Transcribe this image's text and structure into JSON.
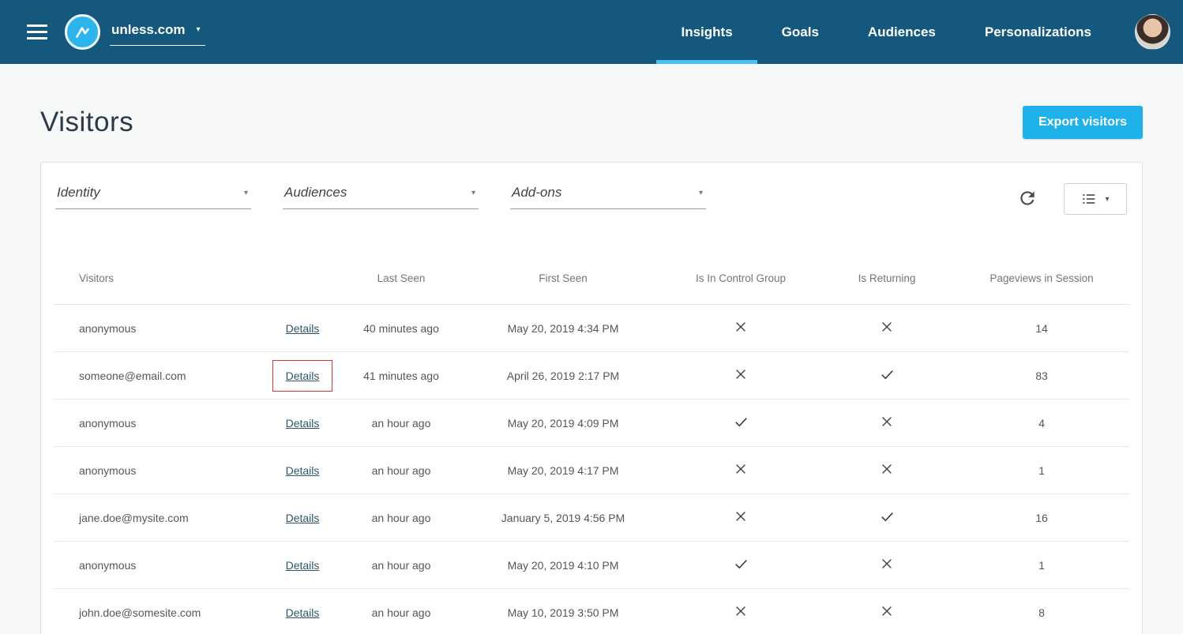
{
  "navbar": {
    "site_name": "unless.com",
    "nav_items": [
      {
        "label": "Insights",
        "active": true
      },
      {
        "label": "Goals",
        "active": false
      },
      {
        "label": "Audiences",
        "active": false
      },
      {
        "label": "Personalizations",
        "active": false
      }
    ]
  },
  "page": {
    "title": "Visitors",
    "export_button": "Export visitors"
  },
  "filters": {
    "dropdowns": [
      {
        "label": "Identity"
      },
      {
        "label": "Audiences"
      },
      {
        "label": "Add-ons"
      }
    ]
  },
  "table": {
    "headers": [
      "Visitors",
      "Last Seen",
      "First Seen",
      "Is In Control Group",
      "Is Returning",
      "Pageviews in Session"
    ],
    "details_label": "Details",
    "rows": [
      {
        "identity": "anonymous",
        "last_seen": "40 minutes ago",
        "first_seen": "May 20, 2019 4:34 PM",
        "in_control_group": false,
        "is_returning": false,
        "pageviews": "14",
        "details_highlighted": false
      },
      {
        "identity": "someone@email.com",
        "last_seen": "41 minutes ago",
        "first_seen": "April 26, 2019 2:17 PM",
        "in_control_group": false,
        "is_returning": true,
        "pageviews": "83",
        "details_highlighted": true
      },
      {
        "identity": "anonymous",
        "last_seen": "an hour ago",
        "first_seen": "May 20, 2019 4:09 PM",
        "in_control_group": true,
        "is_returning": false,
        "pageviews": "4",
        "details_highlighted": false
      },
      {
        "identity": "anonymous",
        "last_seen": "an hour ago",
        "first_seen": "May 20, 2019 4:17 PM",
        "in_control_group": false,
        "is_returning": false,
        "pageviews": "1",
        "details_highlighted": false
      },
      {
        "identity": "jane.doe@mysite.com",
        "last_seen": "an hour ago",
        "first_seen": "January 5, 2019 4:56 PM",
        "in_control_group": false,
        "is_returning": true,
        "pageviews": "16",
        "details_highlighted": false
      },
      {
        "identity": "anonymous",
        "last_seen": "an hour ago",
        "first_seen": "May 20, 2019 4:10 PM",
        "in_control_group": true,
        "is_returning": false,
        "pageviews": "1",
        "details_highlighted": false
      },
      {
        "identity": "john.doe@somesite.com",
        "last_seen": "an hour ago",
        "first_seen": "May 10, 2019 3:50 PM",
        "in_control_group": false,
        "is_returning": false,
        "pageviews": "8",
        "details_highlighted": false
      }
    ]
  },
  "colors": {
    "navbar_bg": "#14587e",
    "accent": "#1fb1ea",
    "active_tab_underline": "#4ac2f1",
    "highlight_box": "#d5342f"
  }
}
